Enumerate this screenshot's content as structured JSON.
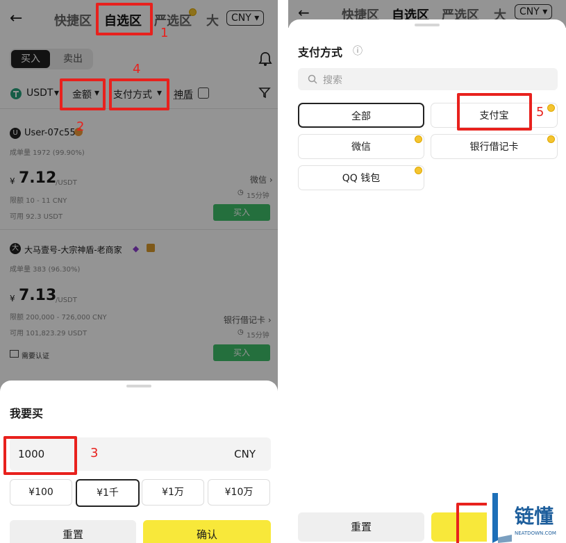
{
  "left": {
    "nav": {
      "back": "←",
      "tabs": [
        "快捷区",
        "自选区",
        "严选区",
        "大"
      ],
      "currency": "CNY",
      "currency_caret": "▾"
    },
    "seg": {
      "buy": "买入",
      "sell": "卖出"
    },
    "filters": {
      "coin": "USDT",
      "amount": "金额",
      "payment": "支付方式",
      "shield": "神盾"
    },
    "listings": [
      {
        "avatar": "U",
        "name": "User-07c55",
        "stats": "成单量 1972 (99.90%)",
        "currency_sym": "¥",
        "price": "7.12",
        "unit": "/USDT",
        "limit": "限额 10 - 11 CNY",
        "avail": "可用 92.3 USDT",
        "method": "微信 ›",
        "time": "15分钟",
        "buy": "买入"
      },
      {
        "avatar": "大",
        "name": "大马壹号-大宗神盾-老商家",
        "stats": "成单量 383 (96.30%)",
        "currency_sym": "¥",
        "price": "7.13",
        "unit": "/USDT",
        "limit": "限额 200,000 - 726,000 CNY",
        "avail": "可用 101,823.29 USDT",
        "method": "银行借记卡 ›",
        "time": "15分钟",
        "buy": "买入",
        "verify": "需要认证"
      }
    ],
    "sheet": {
      "title": "我要买",
      "amount_value": "1000",
      "amount_currency": "CNY",
      "presets": [
        "¥100",
        "¥1千",
        "¥1万",
        "¥10万"
      ],
      "reset": "重置",
      "confirm": "确认"
    },
    "annotations": [
      "1",
      "2",
      "3",
      "4"
    ]
  },
  "right": {
    "nav": {
      "back": "←",
      "tabs": [
        "快捷区",
        "自选区",
        "严选区",
        "大"
      ],
      "currency": "CNY",
      "currency_caret": "▾"
    },
    "title": "支付方式",
    "info_icon": "ⓘ",
    "search_placeholder": "搜索",
    "options": [
      "全部",
      "支付宝",
      "微信",
      "银行借记卡",
      "QQ 钱包"
    ],
    "reset": "重置",
    "annotations": [
      "5"
    ]
  },
  "watermark": {
    "brand": "链懂",
    "sub": "NEATDOWN.COM",
    "letter": "L"
  },
  "colors": {
    "annotation_red": "#e8211d",
    "buy_green": "#3fbf6a",
    "confirm_yellow": "#f8e83a"
  }
}
